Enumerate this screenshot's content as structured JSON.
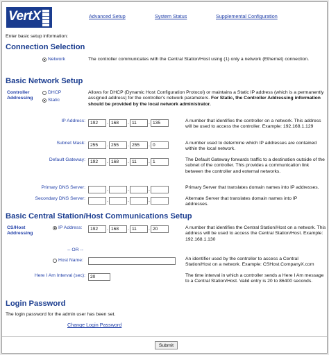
{
  "logo": {
    "text": "VertX"
  },
  "nav": {
    "advanced_setup": "Advanced Setup",
    "system_status": "System Status",
    "supplemental_configuration": "Supplemental Configuration"
  },
  "intro": "Enter basic setup information:",
  "connection": {
    "title": "Connection Selection",
    "option_label": "Network",
    "description": "The controller communicates with the Central Station/Host using (1) only a network (Ethernet) connection."
  },
  "network": {
    "title": "Basic Network Setup",
    "addressing_label": "Controller Addressing",
    "dhcp_label": "DHCP",
    "static_label": "Static",
    "addressing_desc": "Allows for DHCP (Dynamic Host Configuration Protocol) or maintains a Static IP address (which is a permanently assigned address) for the controller's network parameters.",
    "addressing_desc_bold": "For Static, the Controller Addressing information should be provided by the local network administrator.",
    "ip_label": "IP Address:",
    "ip": [
      "192",
      "168",
      "11",
      "135"
    ],
    "ip_desc": "A number that identifies the controller on a network. This address will be used to access the controller. Example: 192.168.1.129",
    "subnet_label": "Subnet Mask:",
    "subnet": [
      "255",
      "255",
      "255",
      "0"
    ],
    "subnet_desc": "A number used to determine which IP addresses are contained within the local network.",
    "gateway_label": "Default Gateway:",
    "gateway": [
      "192",
      "168",
      "11",
      "1"
    ],
    "gateway_desc": "The Default Gateway forwards traffic to a destination outside of the subnet of the controller. This provides a communication link between the controller and external networks.",
    "dns1_label": "Primary DNS Server:",
    "dns1_desc": "Primary Server that translates domain names into IP addresses.",
    "dns2_label": "Secondary DNS Server:",
    "dns2_desc": "Alternate Server that translates domain names into IP addresses."
  },
  "host": {
    "title": "Basic Central Station/Host Communications Setup",
    "addressing_label": "CS/Host Addressing",
    "ip_label": "IP Address:",
    "ip": [
      "192",
      "168",
      "11",
      "20"
    ],
    "ip_desc": "A number that identifies the Central Station/Host on a network. This address will be used to access the Central Station/Host. Example: 192.168.1.130",
    "or_label": "-- OR --",
    "hostname_label": "Host Name:",
    "hostname_value": "",
    "hostname_desc": "An identifier used by the controller to access a Central Station/Host on a network. Example: CSHost.CompanyX.com",
    "interval_label": "Here I Am Interval (sec):",
    "interval_value": "20",
    "interval_desc": "The time interval in which a controller sends a Here I Am message to a Central Station/Host. Valid entry is 20 to 86400 seconds."
  },
  "login": {
    "title": "Login Password",
    "desc": "The login password for the admin user has been set.",
    "change_link": "Change Login Password"
  },
  "submit_label": "Submit"
}
